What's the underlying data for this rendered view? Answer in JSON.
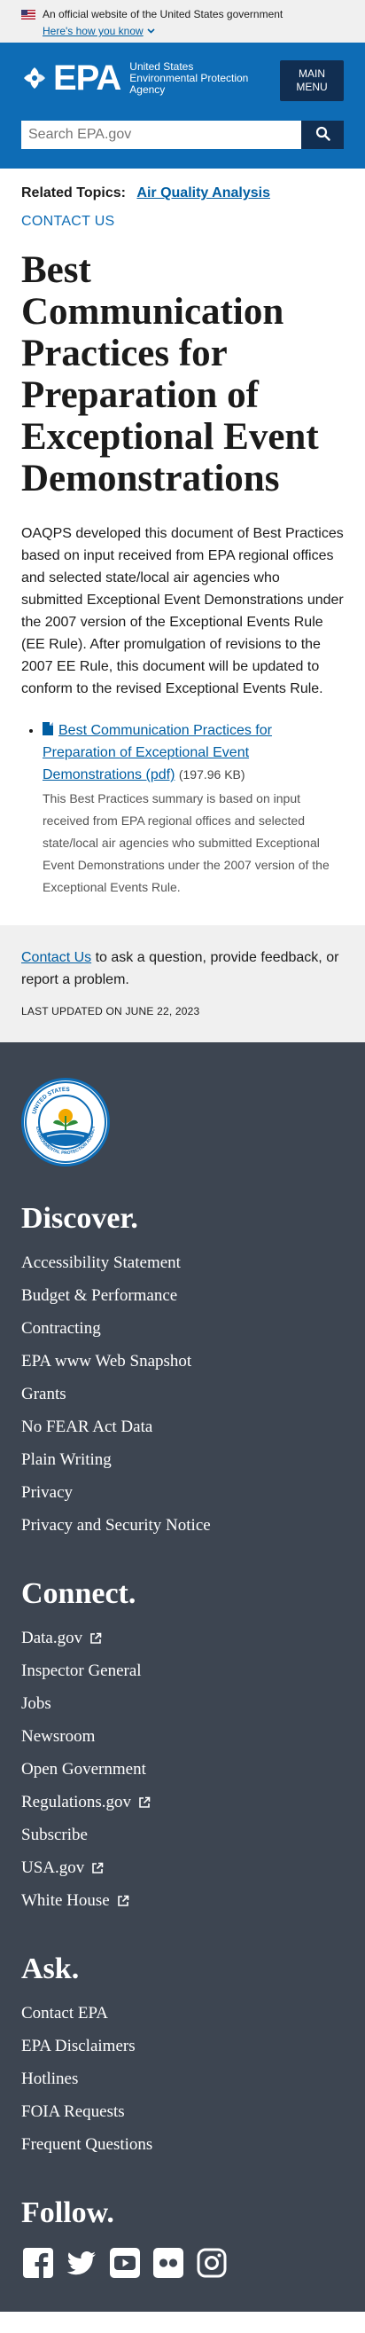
{
  "gov_banner": {
    "text": "An official website of the United States government",
    "link": "Here's how you know"
  },
  "header": {
    "logo_text": "EPA",
    "logo_subtitle_1": "United States",
    "logo_subtitle_2": "Environmental Protection",
    "logo_subtitle_3": "Agency",
    "menu_line_1": "MAIN",
    "menu_line_2": "MENU",
    "search_placeholder": "Search EPA.gov"
  },
  "main": {
    "related_label": "Related Topics:",
    "related_link": "Air Quality Analysis",
    "contact_us_top": "CONTACT US",
    "title": "Best Communication Practices for Preparation of Exceptional Event Demonstrations",
    "intro": "OAQPS developed this document of Best Practices based on input received from EPA regional offices and selected state/local air agencies who submitted Exceptional Event Demonstrations under the 2007 version of the Exceptional Events Rule (EE Rule). After promulgation of revisions to the 2007 EE Rule, this document will be updated to conform to the revised Exceptional Events Rule.",
    "document": {
      "link_text": "Best Communication Practices for Preparation of Exceptional Event Demonstrations (pdf)",
      "file_size": "(197.96 KB)",
      "description": "This Best Practices summary is based on input received from EPA regional offices and selected state/local air agencies who submitted Exceptional Event Demonstrations under the 2007 version of the Exceptional Events Rule."
    }
  },
  "contact_band": {
    "link": "Contact Us",
    "text": " to ask a question, provide feedback, or report a problem.",
    "updated": "LAST UPDATED ON JUNE 22, 2023"
  },
  "footer": {
    "discover": {
      "heading": "Discover.",
      "items": [
        "Accessibility Statement",
        "Budget & Performance",
        "Contracting",
        "EPA www Web Snapshot",
        "Grants",
        "No FEAR Act Data",
        "Plain Writing",
        "Privacy",
        "Privacy and Security Notice"
      ]
    },
    "connect": {
      "heading": "Connect.",
      "items": [
        "Data.gov",
        "Inspector General",
        "Jobs",
        "Newsroom",
        "Open Government",
        "Regulations.gov",
        "Subscribe",
        "USA.gov",
        "White House"
      ]
    },
    "ask": {
      "heading": "Ask.",
      "items": [
        "Contact EPA",
        "EPA Disclaimers",
        "Hotlines",
        "FOIA Requests",
        "Frequent Questions"
      ]
    },
    "follow": {
      "heading": "Follow.",
      "icons": [
        "facebook-icon",
        "twitter-icon",
        "youtube-icon",
        "flickr-icon",
        "instagram-icon"
      ]
    },
    "seal_text": "UNITED STATES · ENVIRONMENTAL PROTECTION AGENCY"
  },
  "colors": {
    "header_blue": "#0e6cb5",
    "navy": "#112e51",
    "link_blue": "#005ea2",
    "footer_bg": "#3d4551",
    "band_bg": "#f0f0f0"
  }
}
